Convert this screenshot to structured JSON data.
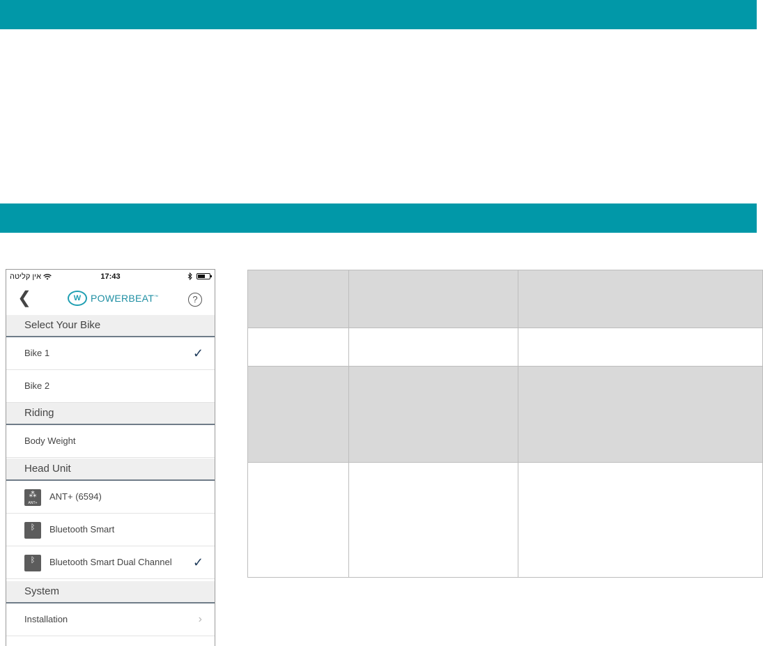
{
  "status_bar": {
    "carrier": "אין קליטה",
    "time": "17:43"
  },
  "nav": {
    "back_glyph": "❮",
    "brand": "POWERBEAT",
    "help_glyph": "?"
  },
  "sections": {
    "select_bike": "Select Your Bike",
    "riding": "Riding",
    "head_unit": "Head Unit",
    "system": "System"
  },
  "rows": {
    "bike1": "Bike 1",
    "bike2": "Bike 2",
    "body_weight": "Body Weight",
    "ant": "ANT+ (6594)",
    "bt_smart": "Bluetooth Smart",
    "bt_dual": "Bluetooth Smart Dual Channel",
    "installation": "Installation"
  },
  "colors": {
    "banner": "#0198a8",
    "table_shade": "#d9d9d9",
    "check": "#1e3a5a"
  },
  "icons": [
    "wifi-icon",
    "bluetooth-icon",
    "battery-icon",
    "back-icon",
    "help-icon",
    "check-icon",
    "chevron-right-icon",
    "ant-plus-icon",
    "bluetooth-smart-icon"
  ]
}
